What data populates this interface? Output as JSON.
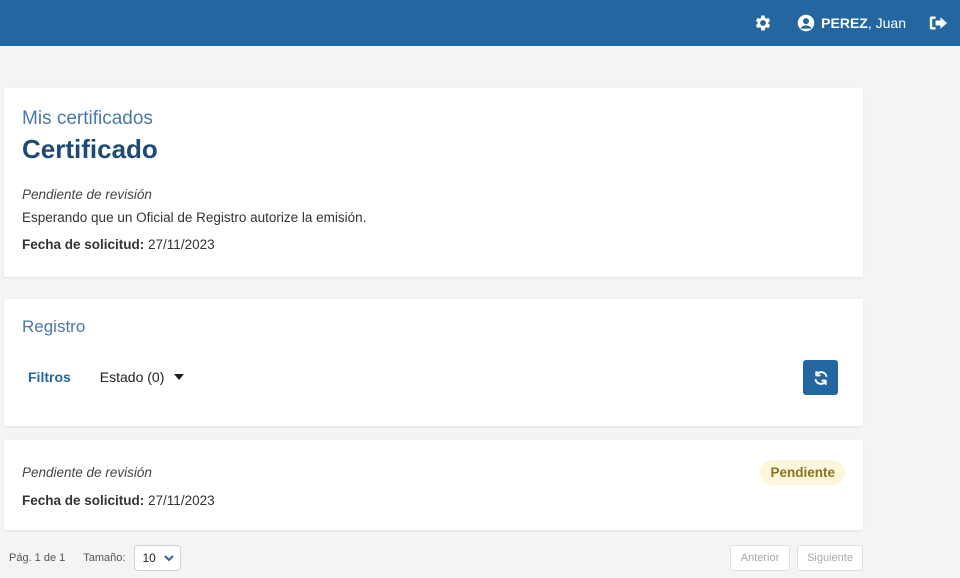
{
  "header": {
    "user_last": "PEREZ",
    "user_first": ", Juan",
    "icons": [
      "gear-icon",
      "user-circle-icon",
      "logout-icon"
    ],
    "bar_color": "#2467a0"
  },
  "summary": {
    "crumb": "Mis certificados",
    "title": "Certificado",
    "status": "Pendiente de revisión",
    "description": "Esperando que un Oficial de Registro autorize la emisión.",
    "date_label": "Fecha de solicitud:",
    "date_value": " 27/11/2023"
  },
  "registro": {
    "title": "Registro",
    "filters_label": "Filtros",
    "estado_label": "Estado (0)",
    "refresh_icon": "refresh-icon"
  },
  "entries": [
    {
      "status": "Pendiente de revisión",
      "date_label": "Fecha de solicitud:",
      "date_value": " 27/11/2023",
      "badge": "Pendiente",
      "badge_color": "#8a7420",
      "badge_bg": "#fbf6dc"
    }
  ],
  "pagination": {
    "page_text": "Pág. 1 de 1",
    "size_label": "Tamaño:",
    "size_value": "10",
    "prev_label": "Anterior",
    "next_label": "Siguiente"
  }
}
